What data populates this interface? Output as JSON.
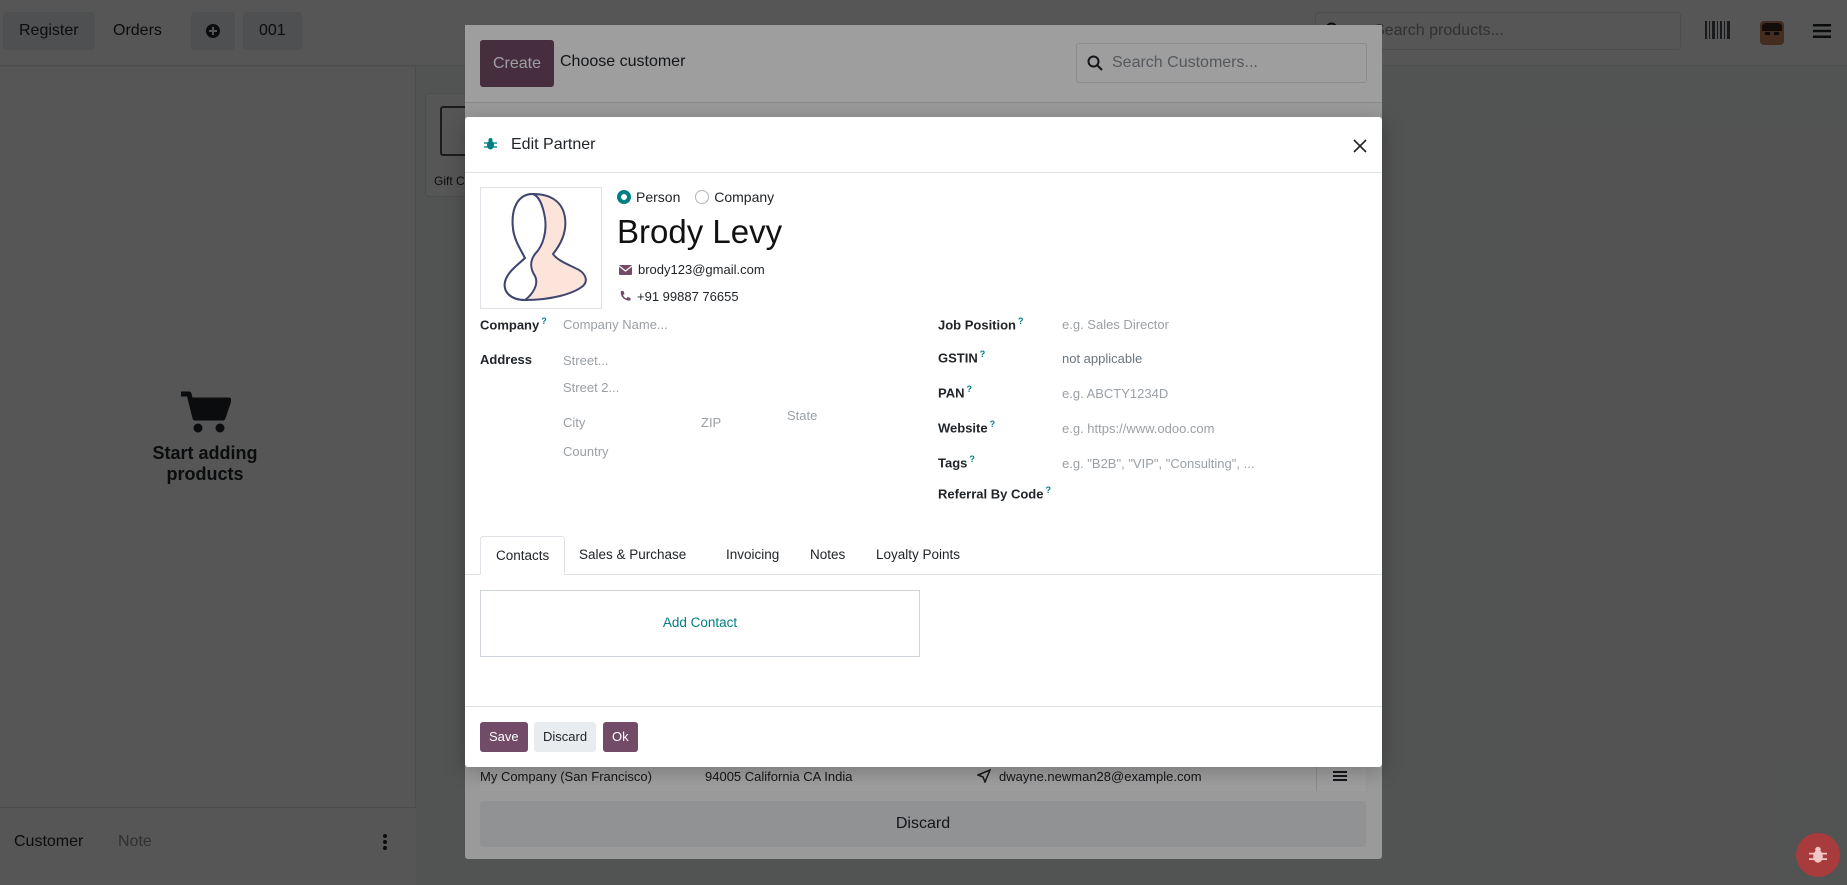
{
  "header": {
    "register_label": "Register",
    "orders_label": "Orders",
    "order_number": "001",
    "search_placeholder": "Search products..."
  },
  "left_pane": {
    "empty_text": "Start adding products",
    "customer_label": "Customer",
    "note_label": "Note"
  },
  "products": [
    {
      "name": "Gift C"
    }
  ],
  "customer_dialog": {
    "create_label": "Create",
    "title": "Choose customer",
    "search_placeholder": "Search Customers...",
    "row": {
      "name": "My Company (San Francisco)",
      "address": "94005 California CA India",
      "email": "dwayne.newman28@example.com"
    },
    "discard_label": "Discard"
  },
  "edit_partner": {
    "title": "Edit Partner",
    "type_options": {
      "person": "Person",
      "company": "Company",
      "selected": "Person"
    },
    "name": "Brody Levy",
    "email": "brody123@gmail.com",
    "phone": "+91 99887 76655",
    "fields_left": {
      "company_label": "Company",
      "company_placeholder": "Company Name...",
      "address_label": "Address",
      "street_placeholder": "Street...",
      "street2_placeholder": "Street 2...",
      "city_placeholder": "City",
      "zip_placeholder": "ZIP",
      "state_placeholder": "State",
      "country_placeholder": "Country"
    },
    "fields_right": {
      "job_position_label": "Job Position",
      "job_position_placeholder": "e.g. Sales Director",
      "gstin_label": "GSTIN",
      "gstin_value": "not applicable",
      "pan_label": "PAN",
      "pan_placeholder": "e.g. ABCTY1234D",
      "website_label": "Website",
      "website_placeholder": "e.g. https://www.odoo.com",
      "tags_label": "Tags",
      "tags_placeholder": "e.g. \"B2B\", \"VIP\", \"Consulting\", ...",
      "referral_label": "Referral By Code"
    },
    "help_mark": "?",
    "tabs": [
      "Contacts",
      "Sales & Purchase",
      "Invoicing",
      "Notes",
      "Loyalty Points"
    ],
    "add_contact_label": "Add Contact",
    "footer": {
      "save": "Save",
      "discard": "Discard",
      "ok": "Ok"
    }
  },
  "colors": {
    "primary": "#714b67",
    "accent": "#017e84"
  }
}
